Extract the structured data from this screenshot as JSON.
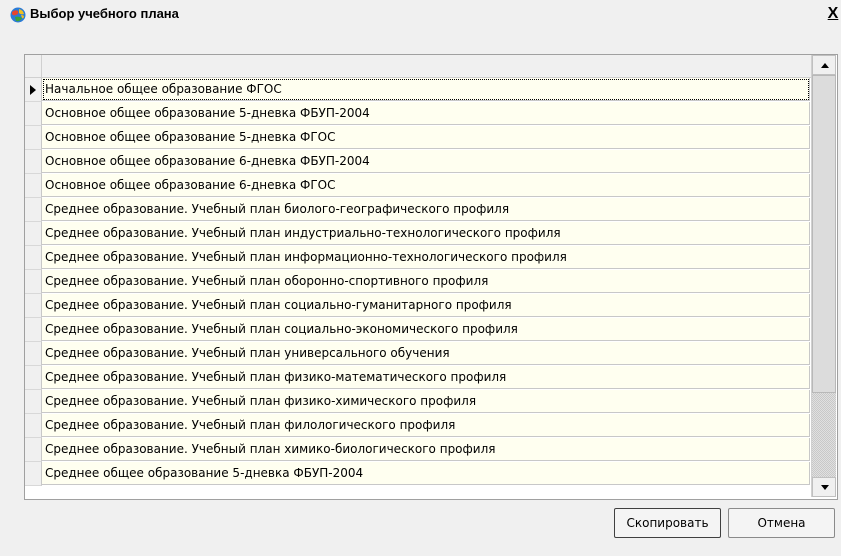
{
  "window": {
    "title": "Выбор учебного плана",
    "close_label": "X",
    "icon": "app-globe-icon"
  },
  "grid": {
    "header_text": "",
    "current_row_index": 0,
    "rows": [
      "Начальное общее образование ФГОС",
      "Основное общее образование 5-дневка ФБУП-2004",
      "Основное общее образование 5-дневка ФГОС",
      "Основное общее образование 6-дневка ФБУП-2004",
      "Основное общее образование 6-дневка ФГОС",
      "Среднее образование. Учебный план биолого-географического профиля",
      "Среднее образование. Учебный план индустриально-технологического профиля",
      "Среднее образование. Учебный план информационно-технологического профиля",
      "Среднее образование. Учебный план оборонно-спортивного профиля",
      "Среднее образование. Учебный план социально-гуманитарного профиля",
      "Среднее образование. Учебный план социально-экономического профиля",
      "Среднее образование. Учебный план универсального обучения",
      "Среднее образование. Учебный план физико-математического профиля",
      "Среднее образование. Учебный план физико-химического профиля",
      "Среднее образование. Учебный план филологического профиля",
      "Среднее образование. Учебный план химико-биологического профиля",
      "Среднее общее образование 5-дневка ФБУП-2004"
    ]
  },
  "buttons": {
    "copy_label": "Скопировать",
    "cancel_label": "Отмена"
  },
  "colors": {
    "row_background": "#fffff0",
    "window_background": "#f0f0f0"
  }
}
